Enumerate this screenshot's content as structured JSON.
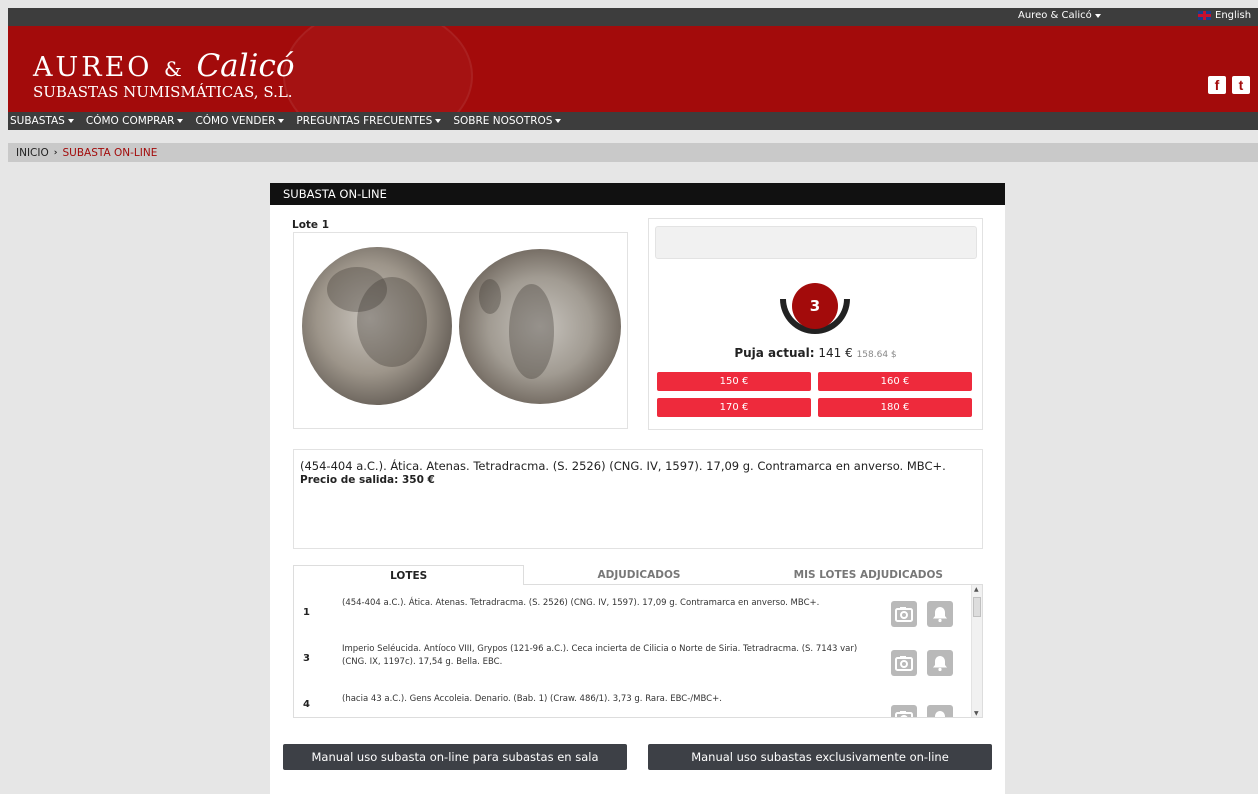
{
  "topbar": {
    "account_menu": "Aureo & Calicó",
    "language": "English"
  },
  "header": {
    "logo_word1": "AUREO",
    "logo_amp": "&",
    "logo_word2": "Calicó",
    "logo_subtitle": "SUBASTAS NUMISMÁTICAS, S.L.",
    "facebook": "f",
    "twitter": "t"
  },
  "nav": {
    "items": [
      "SUBASTAS",
      "CÓMO COMPRAR",
      "CÓMO VENDER",
      "PREGUNTAS FRECUENTES",
      "SOBRE NOSOTROS"
    ]
  },
  "breadcrumb": {
    "home": "INICIO",
    "separator": "›",
    "current": "SUBASTA ON-LINE"
  },
  "panel": {
    "title": "SUBASTA ON-LINE",
    "lot_label": "Lote 1",
    "counter": "3",
    "current_bid_label": "Puja actual:",
    "current_bid_eur": "141 €",
    "current_bid_usd": "158.64 $",
    "bid_options": [
      "150 €",
      "160 €",
      "170 €",
      "180 €"
    ],
    "description": "(454-404 a.C.). Ática. Atenas. Tetradracma. (S. 2526) (CNG. IV, 1597). 17,09 g. Contramarca en anverso. MBC+.",
    "starting_price": "Precio de salida: 350 €"
  },
  "tabs": [
    "LOTES",
    "ADJUDICADOS",
    "MIS LOTES ADJUDICADOS"
  ],
  "lots": [
    {
      "num": "1",
      "text": "(454-404 a.C.). Ática. Atenas. Tetradracma. (S. 2526) (CNG. IV, 1597). 17,09 g. Contramarca en anverso. MBC+."
    },
    {
      "num": "3",
      "text": "Imperio Seléucida. Antíoco VIII, Grypos (121-96 a.C.). Ceca incierta de Cilicia o Norte de Siria. Tetradracma. (S. 7143 var) (CNG. IX, 1197c). 17,54 g. Bella. EBC."
    },
    {
      "num": "4",
      "text": "(hacia 43 a.C.). Gens Accoleia. Denario. (Bab. 1) (Craw. 486/1). 3,73 g. Rara. EBC-/MBC+."
    }
  ],
  "manuals": {
    "room": "Manual uso subasta on-line para subastas en sala",
    "online": "Manual uso subastas exclusivamente on-line"
  },
  "colors": {
    "brand_red": "#a30b0b",
    "bid_red": "#ee2a3c",
    "dark": "#3d3d3d"
  }
}
